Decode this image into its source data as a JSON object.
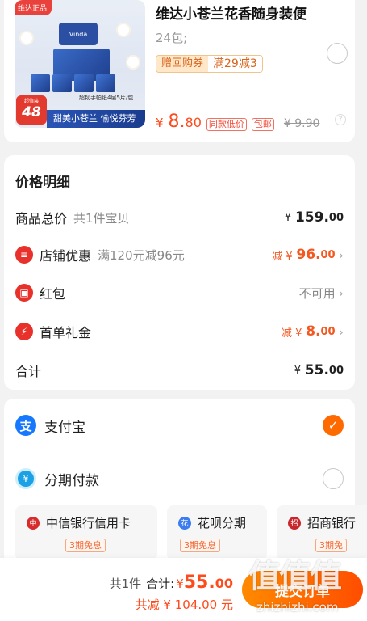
{
  "product": {
    "image_badge": "维达正品",
    "image_logo": "Vinda",
    "image_promo": "超韧手帕纸4层5片/包",
    "image_big_label": "超值装",
    "image_big_num": "48",
    "image_slogan": "甜美小苍兰 愉悦芬芳",
    "title": "维达小苍兰花香随身装便",
    "spec": "24包;",
    "coupon_label": "赠回购券",
    "coupon_value": "满29减3",
    "price_symbol": "¥",
    "price_int": "8.",
    "price_dec": "80",
    "tag_lowest": "同款低价",
    "tag_shipping": "包邮",
    "original_price": "¥ 9.90"
  },
  "detail": {
    "title": "价格明细",
    "rows": [
      {
        "label": "商品总价",
        "sub": "共1件宝贝",
        "symbol": "¥",
        "int": "159.",
        "dec": "00"
      },
      {
        "label": "店铺优惠",
        "sub": "满120元减96元",
        "symbol": "减 ¥",
        "int": "96.",
        "dec": "00"
      },
      {
        "label": "红包",
        "value": "不可用"
      },
      {
        "label": "首单礼金",
        "symbol": "减 ¥",
        "int": "8.",
        "dec": "00"
      },
      {
        "label": "合计",
        "symbol": "¥",
        "int": "55.",
        "dec": "00"
      }
    ]
  },
  "payment": {
    "alipay": "支付宝",
    "installment": "分期付款",
    "banks": [
      {
        "name": "中信银行信用卡",
        "free": "3期免息"
      },
      {
        "name": "花呗分期",
        "free": "3期免息"
      },
      {
        "name": "招商银行",
        "free": "3期免"
      }
    ]
  },
  "footer": {
    "count": "共1件",
    "total_label": "合计:",
    "symbol": "¥",
    "total_int": "55.",
    "total_dec": "00",
    "saved": "共减 ¥ 104.00 元",
    "submit": "提交订单"
  },
  "watermark": {
    "text": "值值值",
    "url": "zhizhizhi.com"
  },
  "colors": {
    "accent": "#ff4a1c",
    "submit_start": "#ff8a00",
    "submit_end": "#ff4d00",
    "alipay_blue": "#1677ff",
    "red_icon": "#e7312a"
  }
}
